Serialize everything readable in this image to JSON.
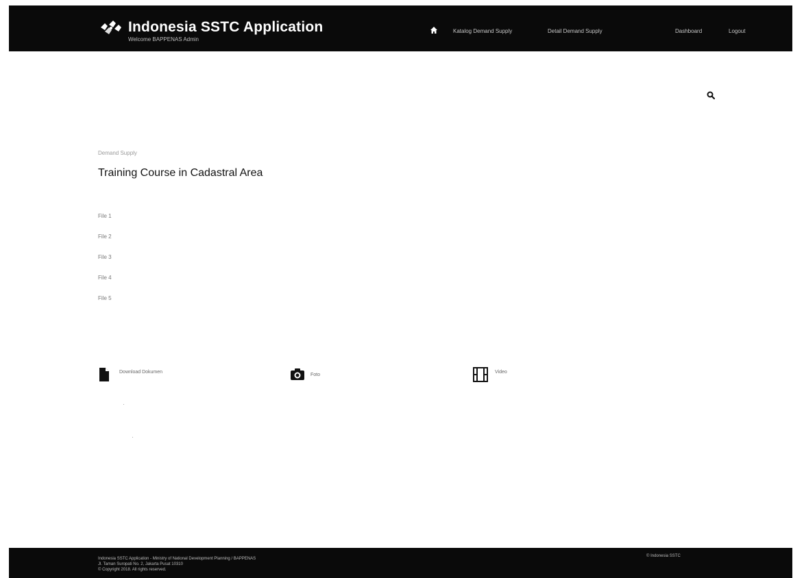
{
  "header": {
    "title": "Indonesia SSTC Application",
    "subtitle": "Welcome BAPPENAS Admin",
    "nav": {
      "home_icon": "home-icon",
      "link1": "Katalog Demand Supply",
      "link2": "Detail Demand Supply",
      "link3": "Dashboard",
      "link4": "Logout"
    }
  },
  "search": {
    "icon": "search-icon"
  },
  "breadcrumb": "Demand Supply",
  "page_title": "Training Course in Cadastral Area",
  "files": [
    "File 1",
    "File 2",
    "File 3",
    "File 4",
    "File 5"
  ],
  "media": {
    "document": {
      "icon": "document-icon",
      "label": "Download Dokumen"
    },
    "photo": {
      "icon": "camera-icon",
      "label": "Foto"
    },
    "video": {
      "icon": "film-icon",
      "label": "Video"
    }
  },
  "footer": {
    "line1": "Indonesia SSTC Application - Ministry of National Development Planning / BAPPENAS",
    "line2": "Jl. Taman Suropati No. 2, Jakarta Pusat 10310",
    "line3": "© Copyright 2018. All rights reserved.",
    "right": "© Indonesia SSTC"
  },
  "colors": {
    "bar_background": "#0a0a0a",
    "page_background": "#ffffff"
  }
}
